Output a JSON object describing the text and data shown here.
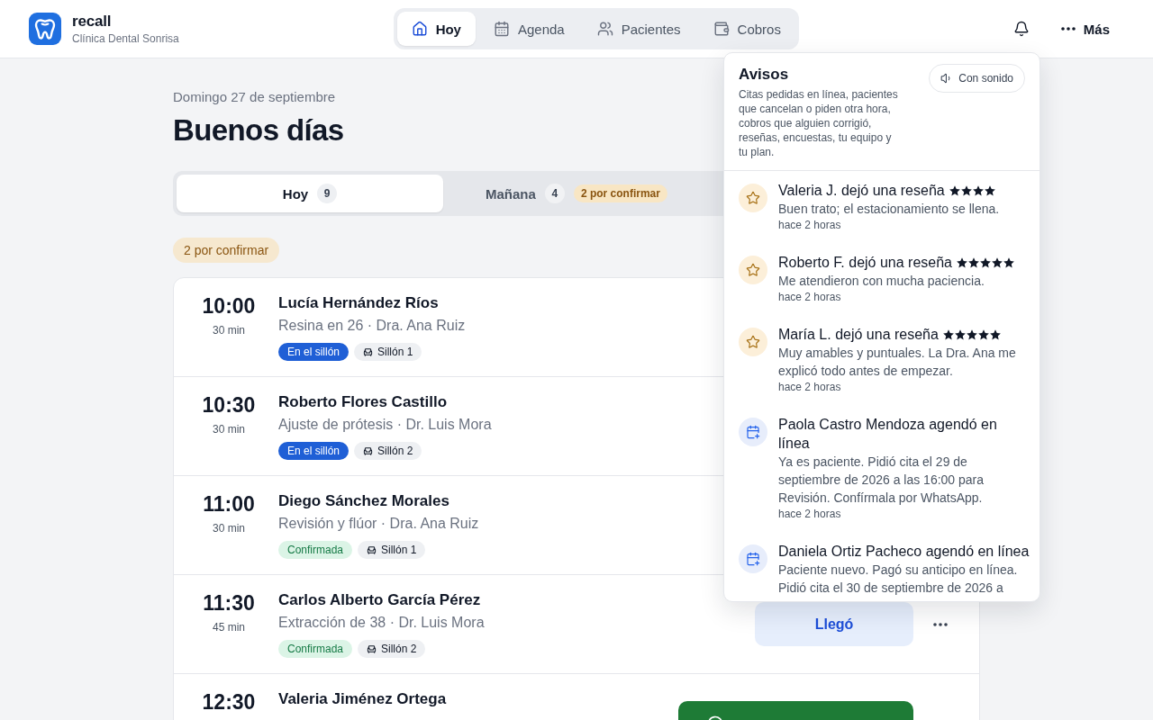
{
  "header": {
    "brand": "recall",
    "clinic": "Clínica Dental Sonrisa",
    "more_label": "Más"
  },
  "nav": [
    {
      "label": "Hoy",
      "selected": true
    },
    {
      "label": "Agenda",
      "selected": false
    },
    {
      "label": "Pacientes",
      "selected": false
    },
    {
      "label": "Cobros",
      "selected": false
    }
  ],
  "main": {
    "date": "Domingo 27 de septiembre",
    "greeting": "Buenos días",
    "day_tabs": [
      {
        "label": "Hoy",
        "count": "9",
        "selected": true
      },
      {
        "label": "Mañana",
        "count": "4",
        "badge": "2 por confirmar",
        "selected": false
      }
    ],
    "pending_badge": "2 por confirmar",
    "appointments": [
      {
        "time": "10:00",
        "duration": "30 min",
        "patient": "Lucía Hernández Ríos",
        "detail": "Resina en 26 · Dra. Ana Ruiz",
        "status": {
          "kind": "in_chair",
          "label": "En el sillón"
        },
        "chair": "Sillón 1",
        "more_menu": false
      },
      {
        "time": "10:30",
        "duration": "30 min",
        "patient": "Roberto Flores Castillo",
        "detail": "Ajuste de prótesis · Dr. Luis Mora",
        "status": {
          "kind": "in_chair",
          "label": "En el sillón"
        },
        "chair": "Sillón 2",
        "more_menu": false
      },
      {
        "time": "11:00",
        "duration": "30 min",
        "patient": "Diego Sánchez Morales",
        "detail": "Revisión y flúor · Dra. Ana Ruiz",
        "status": {
          "kind": "confirmed",
          "label": "Confirmada"
        },
        "chair": "Sillón 1",
        "more_menu": false
      },
      {
        "time": "11:30",
        "duration": "45 min",
        "patient": "Carlos Alberto García Pérez",
        "detail": "Extracción de 38 · Dr. Luis Mora",
        "status": {
          "kind": "confirmed",
          "label": "Confirmada"
        },
        "chair": "Sillón 2",
        "action": {
          "kind": "arrived",
          "label": "Llegó"
        },
        "more_menu": true
      },
      {
        "time": "12:30",
        "patient": "Valeria Jiménez Ortega",
        "action": {
          "kind": "whatsapp"
        },
        "more_menu": false
      }
    ]
  },
  "notifications": {
    "title": "Avisos",
    "description": "Citas pedidas en línea, pacientes que cancelan o piden otra hora, cobros que alguien corrigió, reseñas, encuestas, tu equipo y tu plan.",
    "sound_button": "Con sonido",
    "items": [
      {
        "kind": "review",
        "title": "Valeria J. dejó una reseña",
        "stars": 4,
        "body": "Buen trato; el estacionamiento se llena.",
        "time": "hace 2 horas"
      },
      {
        "kind": "review",
        "title": "Roberto F. dejó una reseña",
        "stars": 5,
        "body": "Me atendieron con mucha paciencia.",
        "time": "hace 2 horas"
      },
      {
        "kind": "review",
        "title": "María L. dejó una reseña",
        "stars": 5,
        "body": "Muy amables y puntuales. La Dra. Ana me explicó todo antes de empezar.",
        "time": "hace 2 horas"
      },
      {
        "kind": "booking",
        "title": "Paola Castro Mendoza agendó en línea",
        "body": "Ya es paciente. Pidió cita el 29 de septiembre de 2026 a las 16:00 para Revisión. Confírmala por WhatsApp.",
        "time": "hace 2 horas"
      },
      {
        "kind": "booking",
        "title": "Daniela Ortiz Pacheco agendó en línea",
        "body": "Paciente nuevo. Pagó su anticipo en línea. Pidió cita el 30 de septiembre de 2026 a"
      }
    ]
  }
}
